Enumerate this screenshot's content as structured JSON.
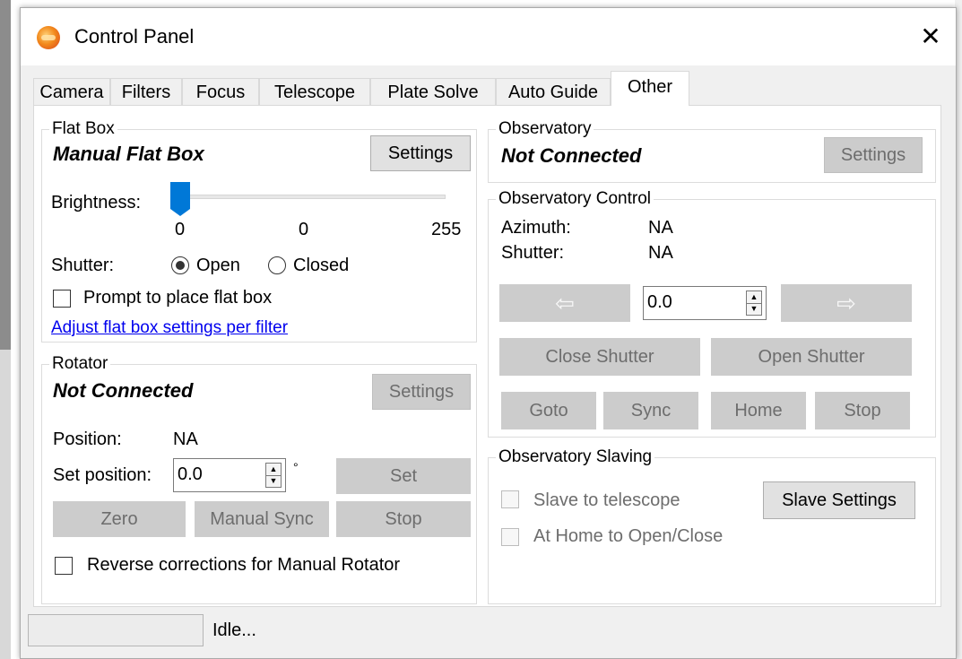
{
  "window": {
    "title": "Control Panel",
    "close_glyph": "✕"
  },
  "tabs": [
    {
      "label": "Camera",
      "active": false
    },
    {
      "label": "Filters",
      "active": false
    },
    {
      "label": "Focus",
      "active": false
    },
    {
      "label": "Telescope",
      "active": false
    },
    {
      "label": "Plate Solve",
      "active": false
    },
    {
      "label": "Auto Guide",
      "active": false
    },
    {
      "label": "Other",
      "active": true
    }
  ],
  "flat_box": {
    "group_title": "Flat Box",
    "device_name": "Manual Flat Box",
    "settings_label": "Settings",
    "brightness_label": "Brightness:",
    "brightness_value": "0",
    "brightness_min": "0",
    "brightness_max": "255",
    "brightness_level": 0,
    "shutter_label": "Shutter:",
    "shutter_open_label": "Open",
    "shutter_closed_label": "Closed",
    "shutter_selected": "Open",
    "prompt_label": "Prompt to place flat box",
    "adjust_link": "Adjust flat box settings per filter"
  },
  "rotator": {
    "group_title": "Rotator",
    "status": "Not Connected",
    "settings_label": "Settings",
    "position_label": "Position:",
    "position_value": "NA",
    "set_position_label": "Set position:",
    "set_position_value": "0.0",
    "degree_symbol": "°",
    "set_label": "Set",
    "zero_label": "Zero",
    "manual_sync_label": "Manual Sync",
    "stop_label": "Stop",
    "reverse_label": "Reverse corrections for Manual Rotator"
  },
  "observatory": {
    "group_title": "Observatory",
    "status": "Not Connected",
    "settings_label": "Settings"
  },
  "observatory_control": {
    "group_title": "Observatory Control",
    "azimuth_label": "Azimuth:",
    "azimuth_value": "NA",
    "shutter_label": "Shutter:",
    "shutter_value": "NA",
    "step_value": "0.0",
    "left_arrow": "⇦",
    "right_arrow": "⇨",
    "close_shutter_label": "Close Shutter",
    "open_shutter_label": "Open Shutter",
    "goto_label": "Goto",
    "sync_label": "Sync",
    "home_label": "Home",
    "stop_label": "Stop"
  },
  "observatory_slaving": {
    "group_title": "Observatory Slaving",
    "slave_label": "Slave to telescope",
    "home_open_close_label": "At Home to Open/Close",
    "slave_settings_label": "Slave Settings"
  },
  "statusbar": {
    "text": "Idle..."
  },
  "colors": {
    "accent": "#0078d7",
    "link": "#0000ee",
    "disabled_button": "#cccccc",
    "icon_orange": "#f28a1c"
  }
}
